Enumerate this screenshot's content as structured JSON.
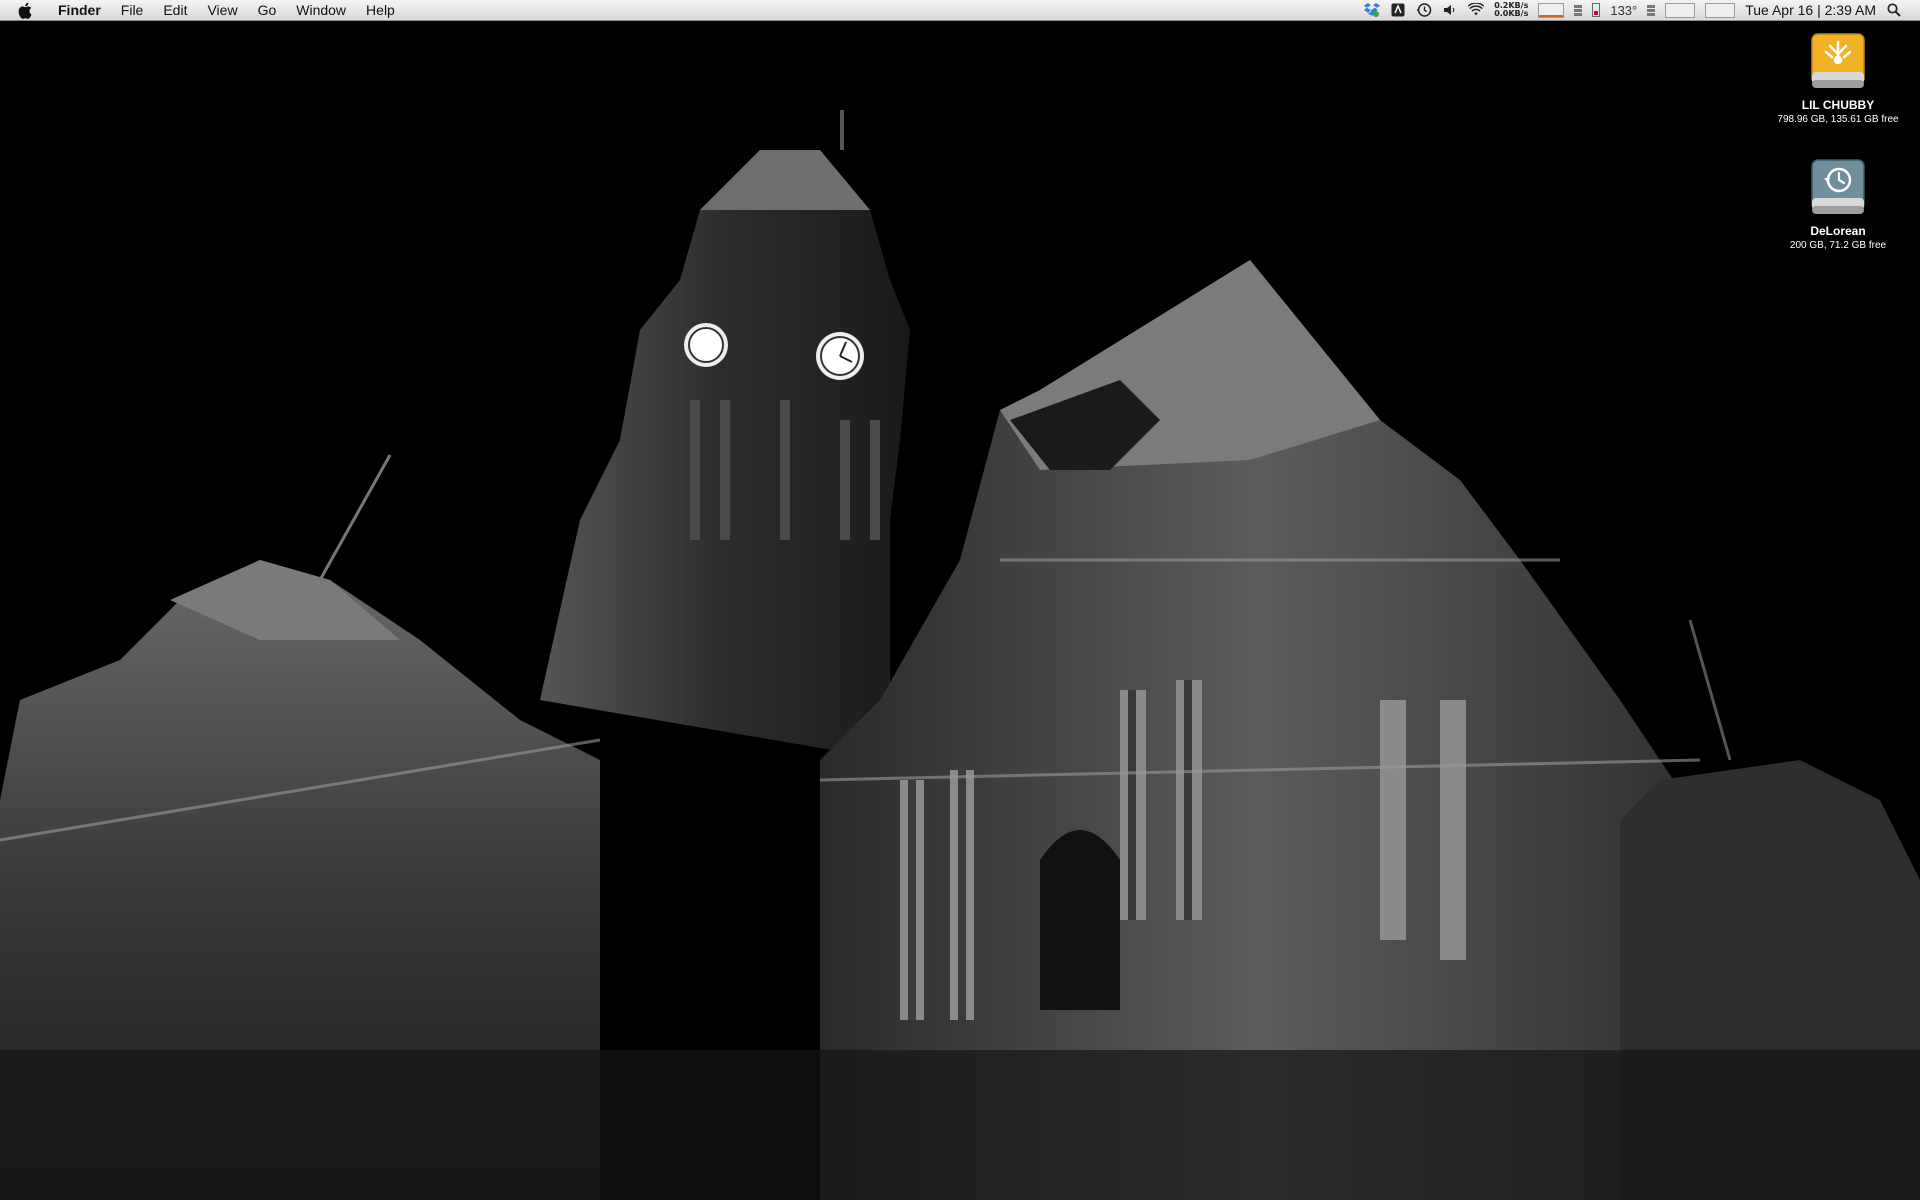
{
  "menubar": {
    "app_name": "Finder",
    "menus": [
      "File",
      "Edit",
      "View",
      "Go",
      "Window",
      "Help"
    ],
    "network": {
      "upload": "0.2KB/s",
      "download": "0.0KB/s"
    },
    "temperature": "133°",
    "clock": "Tue Apr 16 | 2:39 AM"
  },
  "desktop": {
    "icons": [
      {
        "name": "LIL CHUBBY",
        "info": "798.96 GB, 135.61 GB free",
        "icon": "firewire-drive-icon"
      },
      {
        "name": "DeLorean",
        "info": "200 GB, 71.2 GB free",
        "icon": "time-machine-drive-icon"
      }
    ]
  },
  "colors": {
    "menubar_top": "#f4f4f4",
    "menubar_bottom": "#d9d9d9",
    "firewire_drive": "#e8a21a",
    "time_machine_drive": "#5b7d8c"
  }
}
